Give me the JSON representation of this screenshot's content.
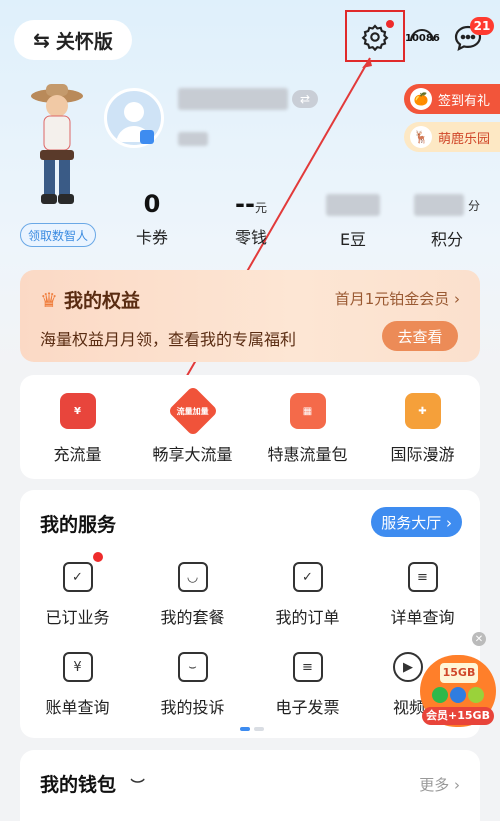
{
  "topbar": {
    "care_mode_label": "关怀版",
    "hotline_label": "10086",
    "message_badge": "21"
  },
  "promos": {
    "sign_in": "签到有礼",
    "deer_park": "萌鹿乐园"
  },
  "profile": {
    "digital_person_label": "领取数智人"
  },
  "stats": [
    {
      "value": "0",
      "unit": "",
      "label": "卡券"
    },
    {
      "value": "--",
      "unit": "元",
      "label": "零钱"
    },
    {
      "value": "",
      "unit": "",
      "label": "E豆"
    },
    {
      "value": "",
      "unit": "分",
      "label": "积分"
    }
  ],
  "rights": {
    "title": "我的权益",
    "promo": "首月1元铂金会员 ›",
    "subtitle": "海量权益月月领，查看我的专属福利",
    "button": "去查看"
  },
  "quick_actions": [
    {
      "label": "充流量",
      "icon": "red-packet-icon"
    },
    {
      "label": "畅享大流量",
      "icon": "data-boost-icon",
      "icon_text": "流量加量"
    },
    {
      "label": "特惠流量包",
      "icon": "data-pack-icon"
    },
    {
      "label": "国际漫游",
      "icon": "roaming-icon"
    }
  ],
  "services": {
    "title": "我的服务",
    "hall_button": "服务大厅 ›",
    "items": [
      {
        "label": "已订业务",
        "icon": "subscribed-icon"
      },
      {
        "label": "我的套餐",
        "icon": "plan-bag-icon"
      },
      {
        "label": "我的订单",
        "icon": "order-icon"
      },
      {
        "label": "详单查询",
        "icon": "detail-list-icon"
      },
      {
        "label": "账单查询",
        "icon": "bill-icon",
        "glyph": "¥"
      },
      {
        "label": "我的投诉",
        "icon": "complaint-icon"
      },
      {
        "label": "电子发票",
        "icon": "invoice-icon"
      },
      {
        "label": "视频",
        "icon": "video-icon"
      }
    ]
  },
  "float_ad": {
    "top_text": "15GB",
    "bottom_text": "会员+15GB"
  },
  "wallet": {
    "title": "我的钱包",
    "more": "更多 ›"
  },
  "colors": {
    "accent_blue": "#3e8cf0",
    "alert_red": "#ee2b2b",
    "rights_orange": "#ec8b57"
  }
}
